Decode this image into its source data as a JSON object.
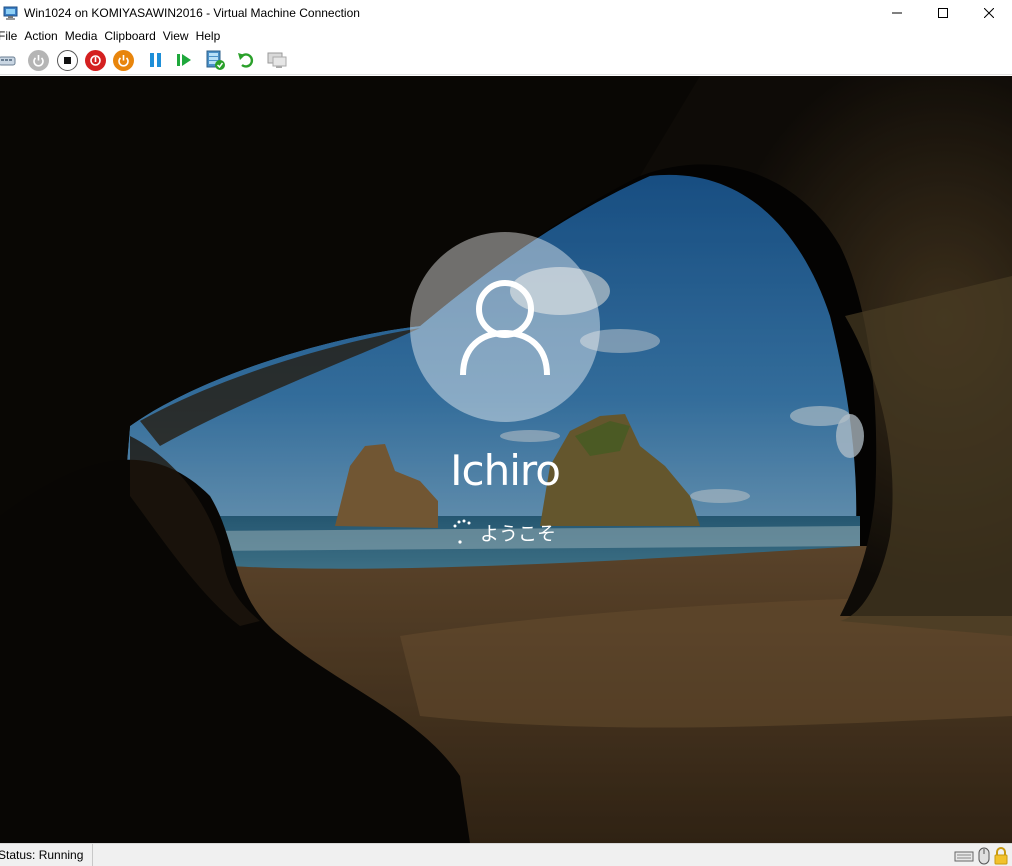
{
  "window": {
    "title": "Win1024 on KOMIYASAWIN2016 - Virtual Machine Connection"
  },
  "menu": {
    "items": [
      "File",
      "Action",
      "Media",
      "Clipboard",
      "View",
      "Help"
    ]
  },
  "toolbar": {
    "buttons": [
      {
        "icon": "ctrl-alt-del-icon"
      },
      {
        "icon": "start-icon"
      },
      {
        "icon": "turn-off-icon"
      },
      {
        "icon": "shut-down-icon"
      },
      {
        "icon": "save-icon"
      },
      {
        "icon": "pause-icon"
      },
      {
        "icon": "resume-icon"
      },
      {
        "icon": "checkpoint-icon"
      },
      {
        "icon": "revert-icon"
      },
      {
        "icon": "enhanced-session-icon"
      }
    ],
    "colors": {
      "turn_off": "#d42020",
      "shut_down": "#e8850c",
      "pause": "#1e8fd8",
      "resume": "#1fa83c",
      "revert": "#2aa02a"
    }
  },
  "vm": {
    "username": "Ichiro",
    "welcome": "ようこそ"
  },
  "status": {
    "text": "Status: Running"
  }
}
